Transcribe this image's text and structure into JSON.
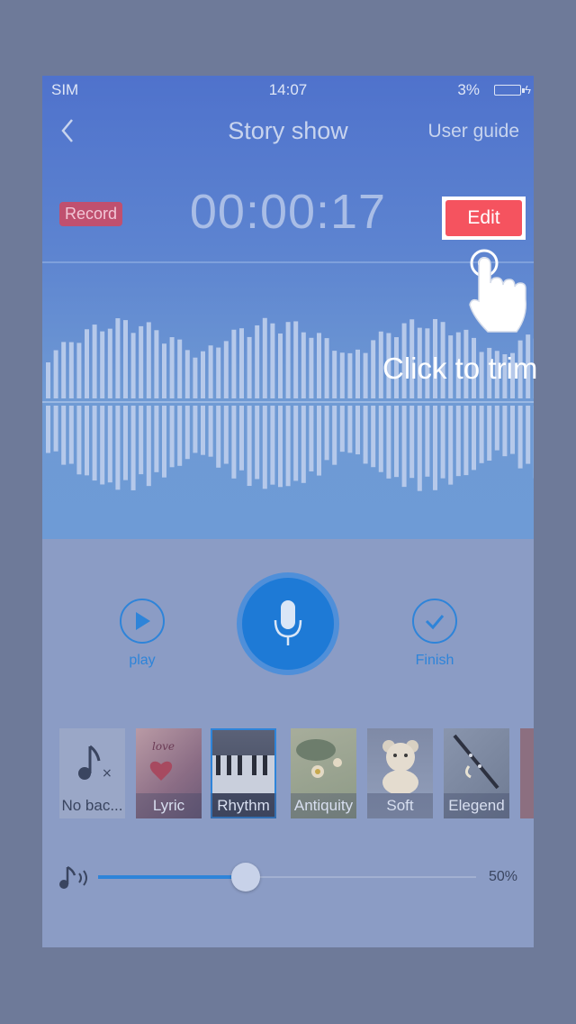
{
  "status_bar": {
    "carrier": "SIM",
    "time": "14:07",
    "battery": "3%"
  },
  "nav": {
    "back_icon": "chevron-left-icon",
    "title": "Story show",
    "user_guide": "User guide"
  },
  "record_badge": "Record",
  "timer": "00:00:17",
  "edit_button": "Edit",
  "hint": "Click to trim",
  "controls": {
    "play_label": "play",
    "finish_label": "Finish"
  },
  "music_styles": [
    {
      "label": "No bac...",
      "selected": false
    },
    {
      "label": "Lyric",
      "selected": false
    },
    {
      "label": "Rhythm",
      "selected": true
    },
    {
      "label": "Antiquity",
      "selected": false
    },
    {
      "label": "Soft",
      "selected": false
    },
    {
      "label": "Elegend",
      "selected": false
    }
  ],
  "volume": {
    "value": 0.5,
    "label": "50%"
  },
  "colors": {
    "accent": "#2e84d9",
    "edit": "#f5535f",
    "record": "#c0506f"
  }
}
